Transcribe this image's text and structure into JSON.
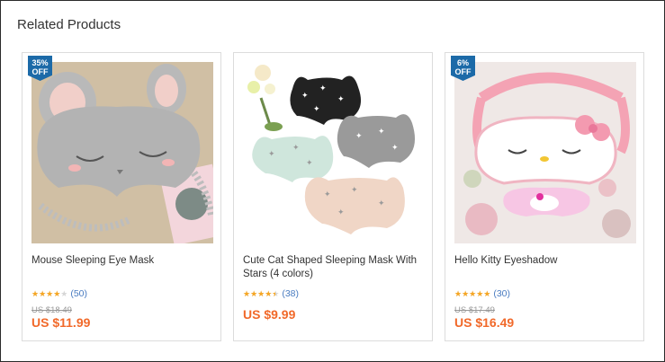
{
  "section": {
    "title": "Related Products"
  },
  "products": [
    {
      "badge": {
        "percent": "35%",
        "off": "OFF"
      },
      "name": "Mouse Sleeping Eye Mask",
      "rating": 4,
      "review_count": "(50)",
      "old_price": "US $18.49",
      "price": "US $11.99"
    },
    {
      "name": "Cute Cat Shaped Sleeping Mask With Stars (4 colors)",
      "rating": 4.5,
      "review_count": "(38)",
      "price": "US $9.99"
    },
    {
      "badge": {
        "percent": "6%",
        "off": "OFF"
      },
      "name": "Hello Kitty Eyeshadow",
      "rating": 5,
      "review_count": "(30)",
      "old_price": "US $17.49",
      "price": "US $16.49"
    }
  ],
  "colors": {
    "badge": "#1c6aa8",
    "price": "#f1692a",
    "star": "#f6a623",
    "review_link": "#4a7cc1"
  }
}
